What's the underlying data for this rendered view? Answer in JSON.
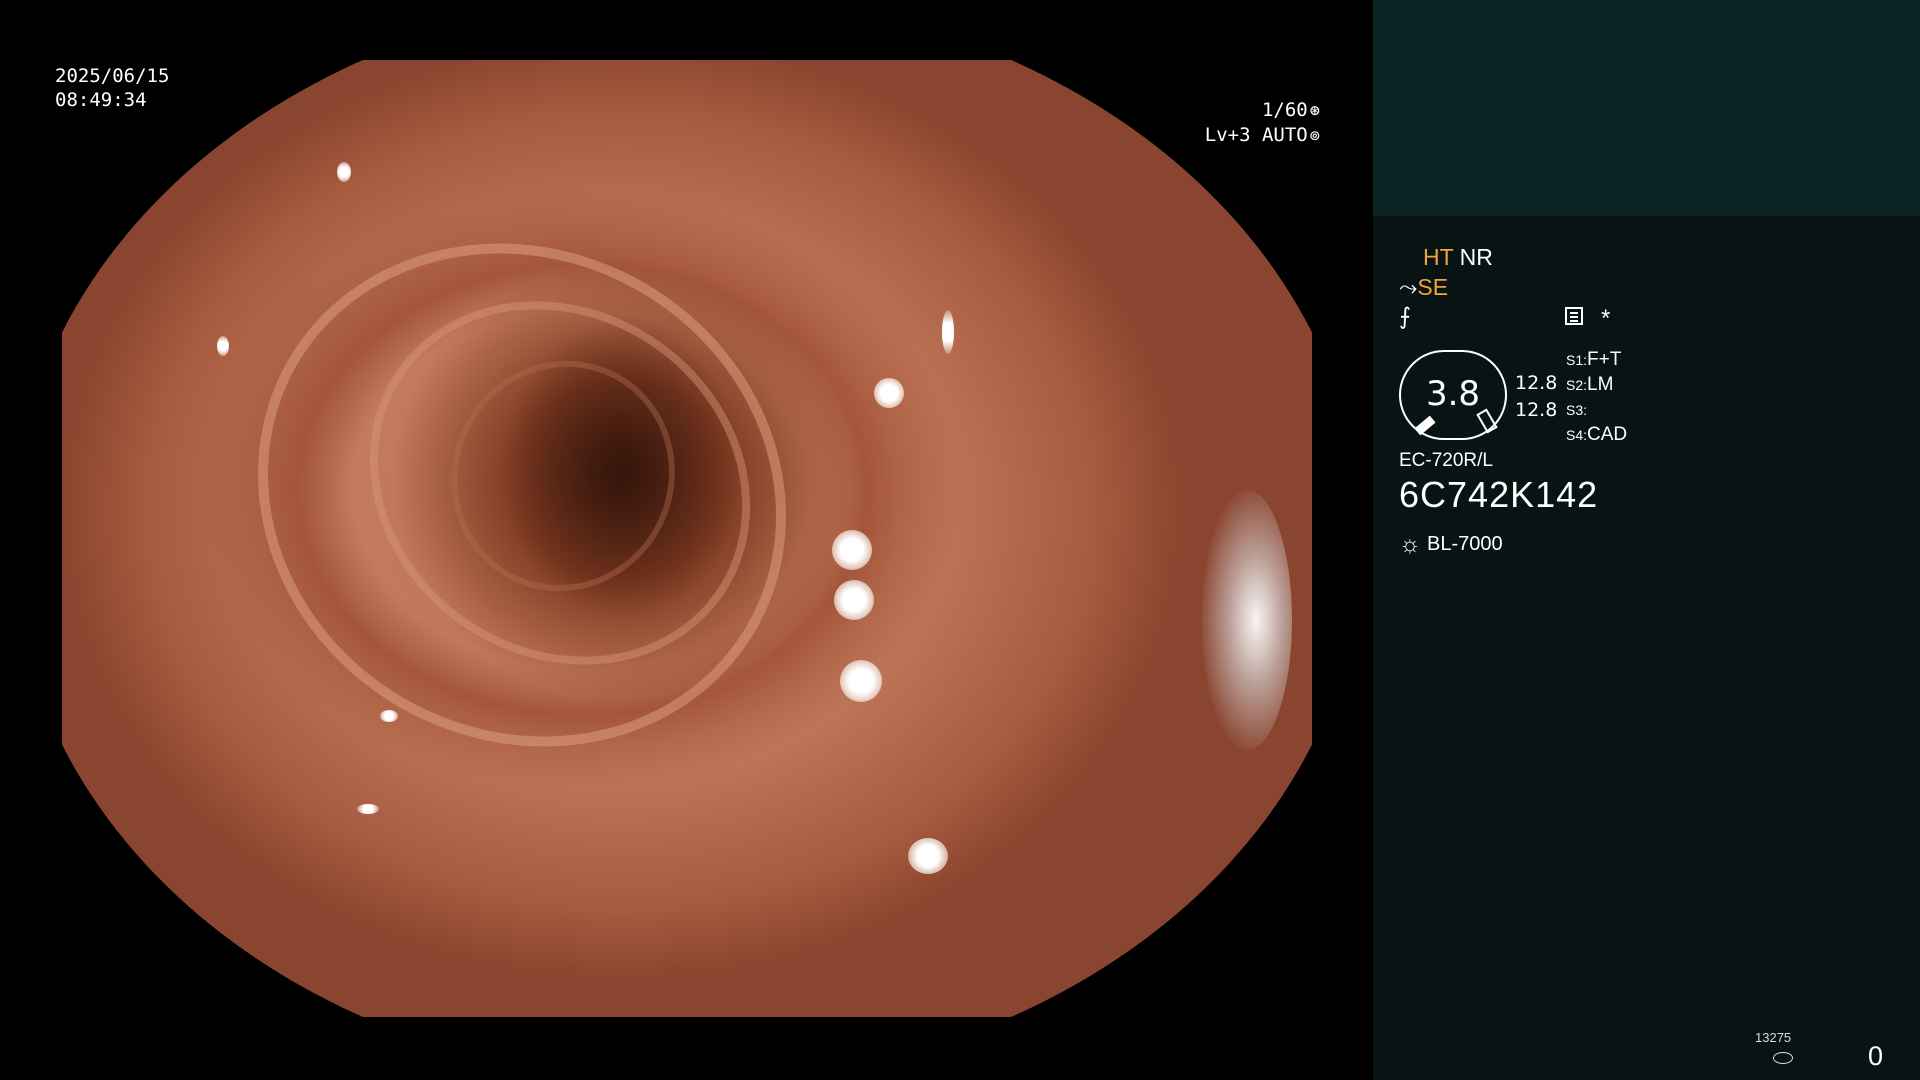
{
  "osd": {
    "date": "2025/06/15",
    "time": "08:49:34",
    "shutter": "1/60",
    "shutter_icon": "aperture-icon",
    "level": "Lv+3",
    "iris": "AUTO",
    "iris_icon": "iris-icon"
  },
  "panel": {
    "mode_row1": {
      "ht": "HT",
      "nr": "NR"
    },
    "mode_row2": {
      "prefix_glyph": "⤳",
      "se": "SE"
    },
    "mode_row3": {
      "glyph": "⨍",
      "menu_icon": "menu-list-icon",
      "asterisk": "*"
    },
    "gauge": {
      "value": "3.8",
      "upper": "12.8",
      "lower": "12.8"
    },
    "switches": [
      {
        "key": "S1",
        "value": "F+T"
      },
      {
        "key": "S2",
        "value": "LM"
      },
      {
        "key": "S3",
        "value": ""
      },
      {
        "key": "S4",
        "value": "CAD"
      }
    ],
    "scope_model": "EC-720R/L",
    "scope_serial": "6C742K142",
    "light_source": "BL-7000",
    "light_icon": "sun-icon"
  },
  "footer": {
    "counter": "13275",
    "storage_icon": "disk-icon",
    "right_value": "0"
  },
  "colors": {
    "accent_orange": "#f2a23a",
    "panel_bg": "#081313",
    "panel_top_bg": "#0d2424"
  }
}
